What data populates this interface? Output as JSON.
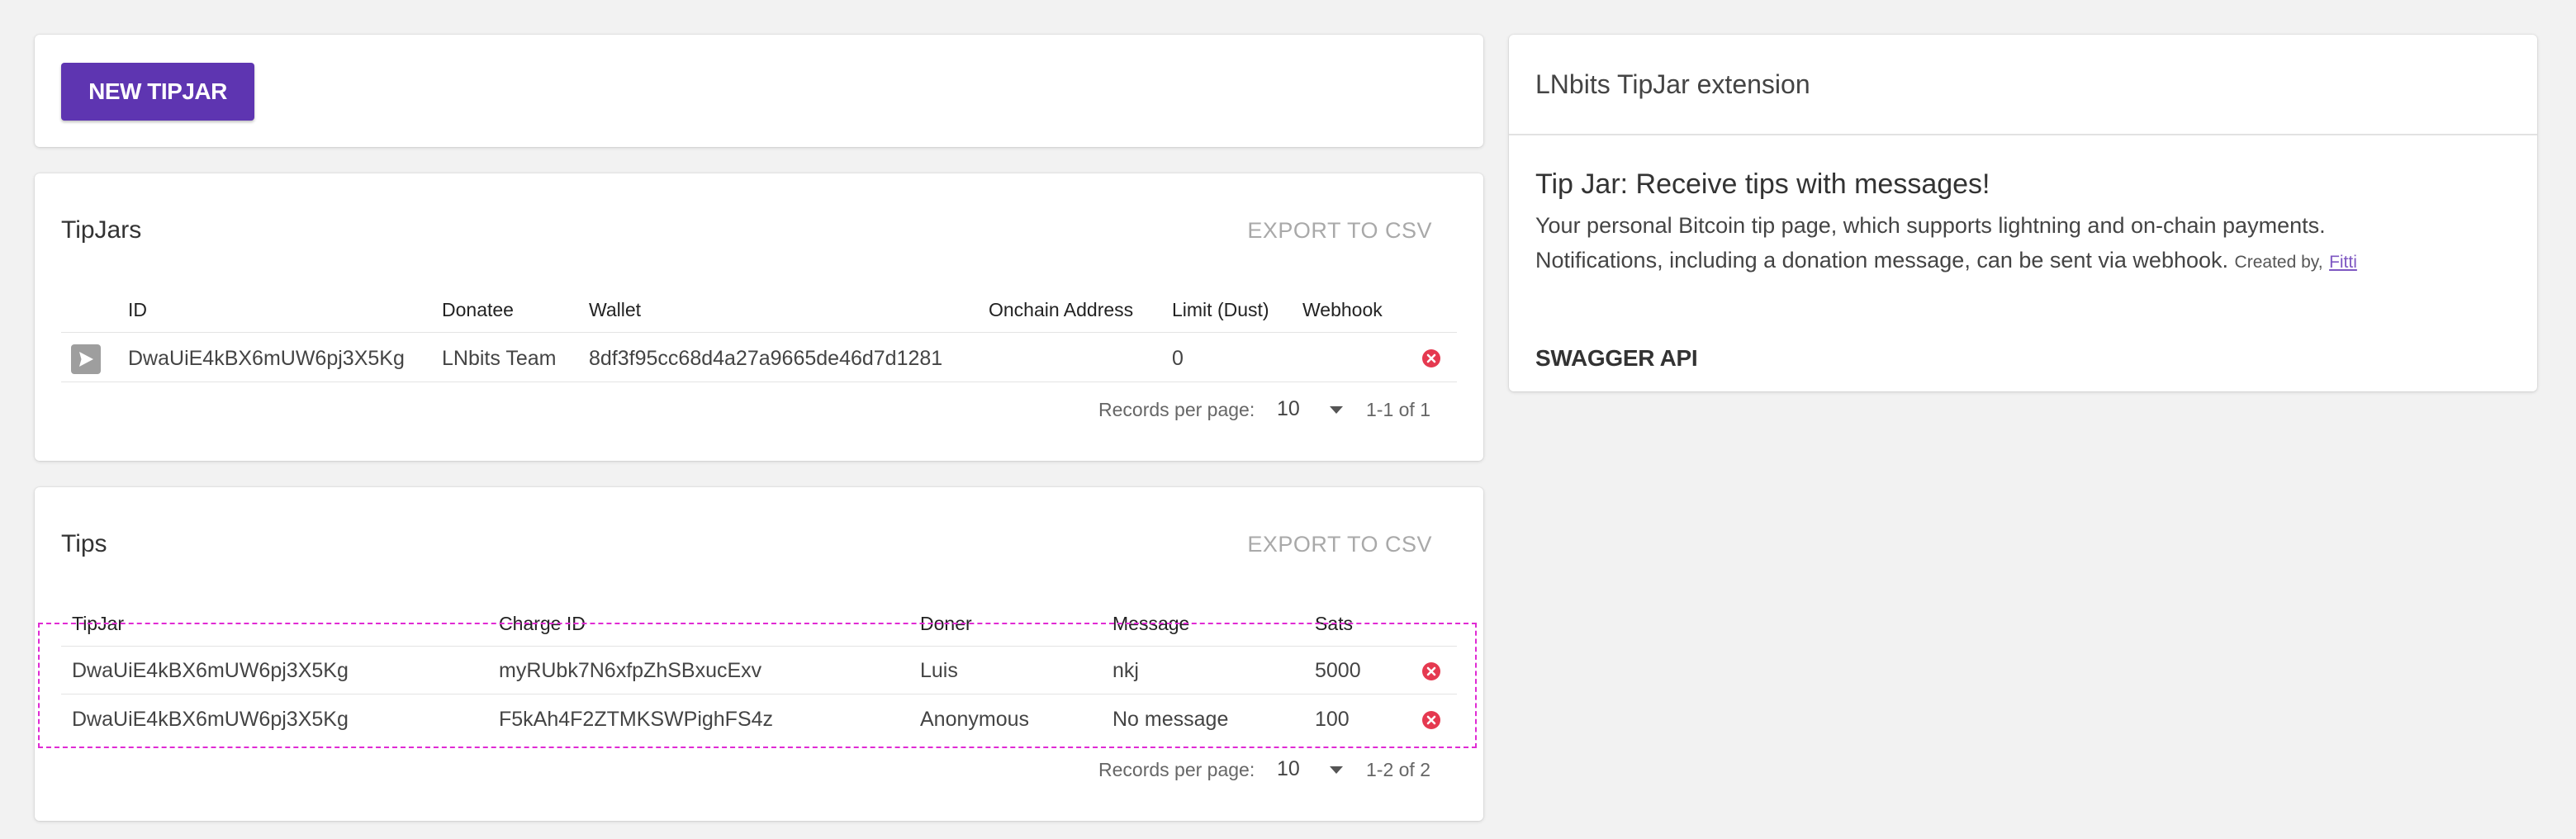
{
  "new_card": {
    "button_label": "NEW TIPJAR"
  },
  "tipjars": {
    "title": "TipJars",
    "export_label": "EXPORT TO CSV",
    "columns": [
      "ID",
      "Donatee",
      "Wallet",
      "Onchain Address",
      "Limit (Dust)",
      "Webhook"
    ],
    "rows": [
      {
        "id": "DwaUiE4kBX6mUW6pj3X5Kg",
        "donatee": "LNbits Team",
        "wallet": "8df3f95cc68d4a27a9665de46d7d1281",
        "onchain": "",
        "limit": "0",
        "webhook": ""
      }
    ],
    "pager": {
      "label": "Records per page:",
      "per_page": "10",
      "range": "1-1 of 1"
    }
  },
  "tips": {
    "title": "Tips",
    "export_label": "EXPORT TO CSV",
    "columns": [
      "TipJar",
      "Charge ID",
      "Doner",
      "Message",
      "Sats"
    ],
    "rows": [
      {
        "tipjar": "DwaUiE4kBX6mUW6pj3X5Kg",
        "charge_id": "myRUbk7N6xfpZhSBxucExv",
        "doner": "Luis",
        "message": "nkj",
        "sats": "5000"
      },
      {
        "tipjar": "DwaUiE4kBX6mUW6pj3X5Kg",
        "charge_id": "F5kAh4F2ZTMKSWPighFS4z",
        "doner": "Anonymous",
        "message": "No message",
        "sats": "100"
      }
    ],
    "pager": {
      "label": "Records per page:",
      "per_page": "10",
      "range": "1-2 of 2"
    }
  },
  "info": {
    "title": "LNbits TipJar extension",
    "heading": "Tip Jar: Receive tips with messages!",
    "line1": "Your personal Bitcoin tip page, which supports lightning and on-chain payments.",
    "line2": "Notifications, including a donation message, can be sent via webhook.",
    "created_by": "Created by,",
    "author": "Fitti",
    "swagger_label": "SWAGGER API"
  },
  "colors": {
    "primary": "#5e35b1",
    "delete": "#e53950",
    "highlight": "#e02bd4",
    "link": "#7e57c2"
  },
  "icons": {
    "send": "send-icon",
    "delete": "cancel-icon",
    "dropdown": "caret-down-icon"
  }
}
